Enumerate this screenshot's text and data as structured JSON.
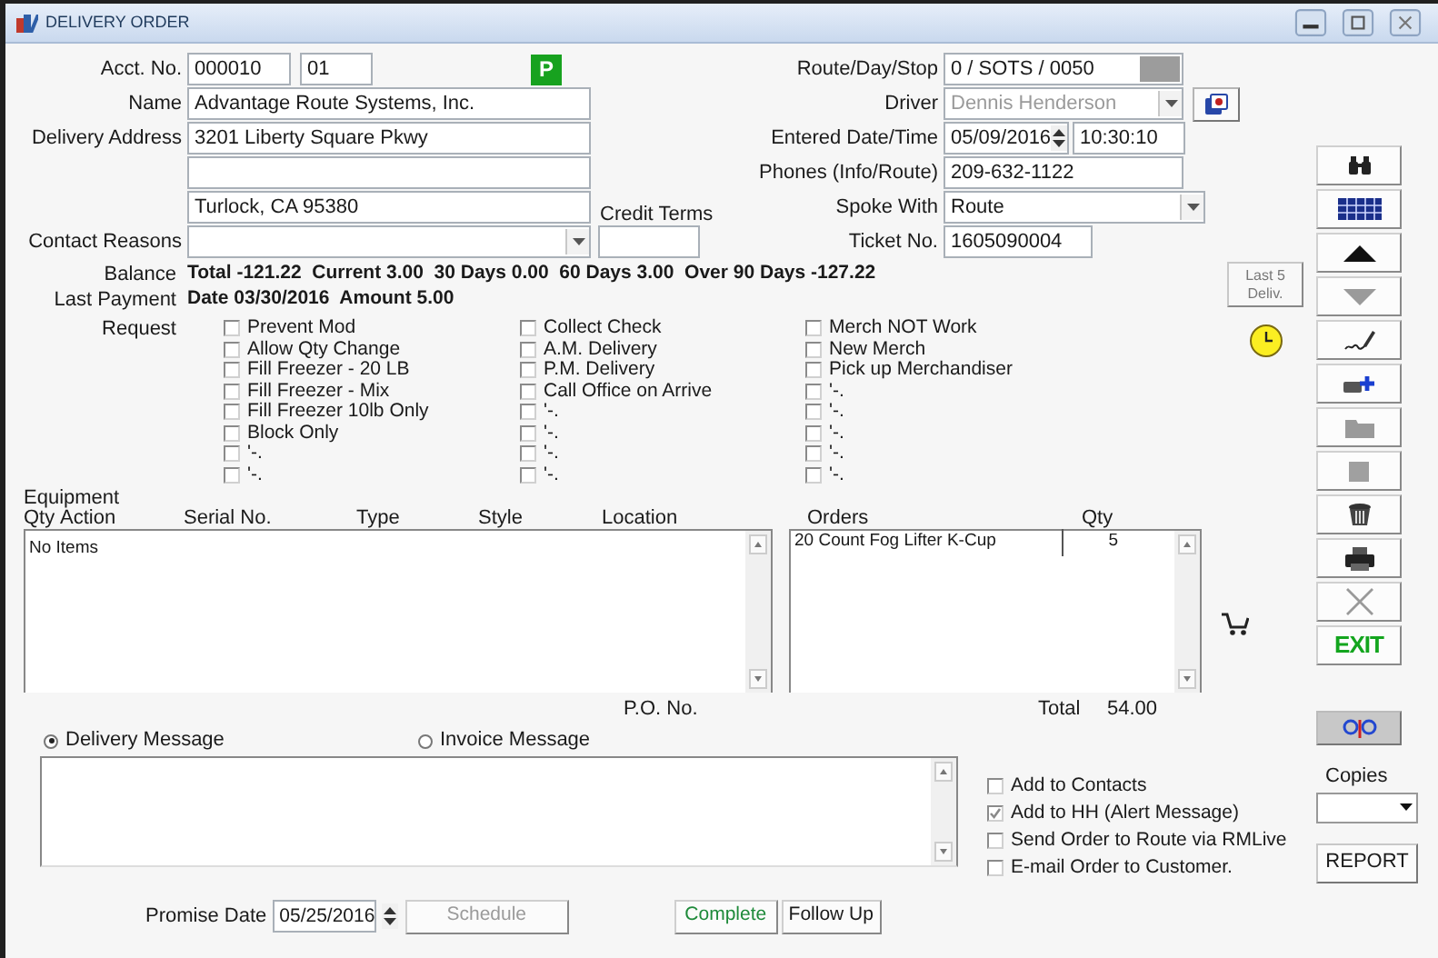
{
  "window": {
    "title": "DELIVERY ORDER"
  },
  "account": {
    "label": "Acct. No.",
    "number": "000010",
    "suffix": "01",
    "badge": "P"
  },
  "name": {
    "label": "Name",
    "value": "Advantage Route Systems, Inc."
  },
  "delivery_address": {
    "label": "Delivery Address",
    "street": "3201 Liberty Square Pkwy",
    "city": "Turlock, CA 95380"
  },
  "credit_terms": {
    "label": "Credit Terms"
  },
  "contact_reasons": {
    "label": "Contact Reasons"
  },
  "route_day_stop": {
    "label": "Route/Day/Stop",
    "value": "0 / SOTS / 0050"
  },
  "driver": {
    "label": "Driver",
    "value": "Dennis Henderson",
    "disabled": true
  },
  "entered": {
    "label": "Entered Date/Time",
    "date": "05/09/2016",
    "time": "10:30:10"
  },
  "phones": {
    "label": "Phones (Info/Route)",
    "value": "209-632-1122"
  },
  "spoke_with": {
    "label": "Spoke With",
    "value": "Route"
  },
  "ticket": {
    "label": "Ticket No.",
    "value": "1605090004"
  },
  "balance": {
    "label": "Balance",
    "text": "Total -121.22  Current 3.00  30 Days 0.00  60 Days 3.00  Over 90 Days -127.22"
  },
  "last_payment": {
    "label": "Last Payment",
    "text": "Date 03/30/2016  Amount 5.00"
  },
  "last_deliveries_button": "Last 5 Deliv.",
  "request": {
    "label": "Request",
    "columns": [
      [
        {
          "label": "Prevent Mod",
          "checked": false
        },
        {
          "label": "Allow Qty Change",
          "checked": false
        },
        {
          "label": "Fill Freezer - 20 LB",
          "checked": false
        },
        {
          "label": "Fill Freezer - Mix",
          "checked": false
        },
        {
          "label": "Fill Freezer 10lb Only",
          "checked": false
        },
        {
          "label": "Block Only",
          "checked": false
        },
        {
          "label": "'-.",
          "checked": false
        },
        {
          "label": "'-.",
          "checked": false
        }
      ],
      [
        {
          "label": "Collect Check",
          "checked": false
        },
        {
          "label": "A.M. Delivery",
          "checked": false
        },
        {
          "label": "P.M. Delivery",
          "checked": false
        },
        {
          "label": "Call Office on Arrive",
          "checked": false
        },
        {
          "label": "'-.",
          "checked": false
        },
        {
          "label": "'-.",
          "checked": false
        },
        {
          "label": "'-.",
          "checked": false
        },
        {
          "label": "'-.",
          "checked": false
        }
      ],
      [
        {
          "label": "Merch NOT Work",
          "checked": false
        },
        {
          "label": "New Merch",
          "checked": false
        },
        {
          "label": "Pick up Merchandiser",
          "checked": false
        },
        {
          "label": "'-.",
          "checked": false
        },
        {
          "label": "'-.",
          "checked": false
        },
        {
          "label": "'-.",
          "checked": false
        },
        {
          "label": "'-.",
          "checked": false
        },
        {
          "label": "'-.",
          "checked": false
        }
      ]
    ]
  },
  "equipment": {
    "title": "Equipment",
    "columns": [
      "Qty",
      "Action",
      "Serial No.",
      "Type",
      "Style",
      "Location"
    ],
    "empty_text": "No Items"
  },
  "orders": {
    "columns": [
      "Orders",
      "Qty"
    ],
    "rows": [
      {
        "item": "20 Count Fog Lifter K-Cup",
        "qty": "5"
      }
    ]
  },
  "po_label": "P.O. No.",
  "total": {
    "label": "Total",
    "value": "54.00"
  },
  "message_type": [
    {
      "label": "Delivery Message",
      "selected": true
    },
    {
      "label": "Invoice Message",
      "selected": false
    }
  ],
  "options": [
    {
      "label": "Add to Contacts",
      "checked": false
    },
    {
      "label": "Add to HH (Alert Message)",
      "checked": true
    },
    {
      "label": "Send Order to Route via RMLive",
      "checked": false
    },
    {
      "label": "E-mail Order to Customer.",
      "checked": false
    }
  ],
  "promise_date": {
    "label": "Promise Date",
    "value": "05/25/2016"
  },
  "buttons": [
    {
      "label": "Schedule",
      "kind": "disabled"
    },
    {
      "label": "Complete",
      "kind": "confirm"
    },
    {
      "label": "Follow Up",
      "kind": "normal"
    }
  ],
  "toolbar": [
    {
      "kind": "binoculars"
    },
    {
      "kind": "grid"
    },
    {
      "kind": "up"
    },
    {
      "kind": "down"
    },
    {
      "kind": "signature"
    },
    {
      "kind": "add"
    },
    {
      "kind": "folder"
    },
    {
      "kind": "stop"
    },
    {
      "kind": "basket"
    },
    {
      "kind": "printer"
    },
    {
      "kind": "cancel"
    },
    {
      "kind": "exit",
      "label": "EXIT"
    }
  ],
  "copies": {
    "label": "Copies"
  },
  "report_button": "REPORT"
}
